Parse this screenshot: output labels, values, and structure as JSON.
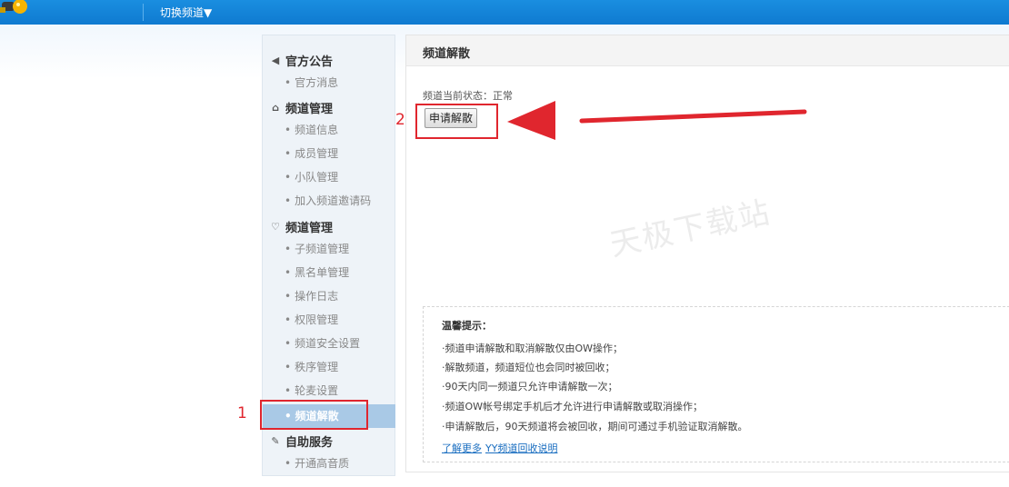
{
  "topbar": {
    "switch_label": "切换频道▼"
  },
  "sidebar": {
    "groups": [
      {
        "label": "官方公告",
        "icon": "speaker-icon"
      },
      {
        "label": "频道管理",
        "icon": "home-icon"
      },
      {
        "label": "频道管理",
        "icon": "shield-icon"
      },
      {
        "label": "自助服务",
        "icon": "wrench-icon"
      }
    ],
    "items": [
      {
        "label": "官方消息"
      },
      {
        "label": "频道信息"
      },
      {
        "label": "成员管理"
      },
      {
        "label": "小队管理"
      },
      {
        "label": "加入频道邀请码"
      },
      {
        "label": "子频道管理"
      },
      {
        "label": "黑名单管理"
      },
      {
        "label": "操作日志"
      },
      {
        "label": "权限管理"
      },
      {
        "label": "频道安全设置"
      },
      {
        "label": "秩序管理"
      },
      {
        "label": "轮麦设置"
      },
      {
        "label": "频道解散",
        "active": true
      },
      {
        "label": "开通高音质"
      }
    ],
    "bullet": "•"
  },
  "main": {
    "title": "频道解散",
    "status_label": "频道当前状态：",
    "status_value": "正常",
    "dissolve_button": "申请解散",
    "watermark": "天极下载站"
  },
  "tips": {
    "title": "温馨提示：",
    "lines": [
      "·频道申请解散和取消解散仅由OW操作；",
      "·解散频道，频道短位也会同时被回收；",
      "·90天内同一频道只允许申请解散一次；",
      "·频道OW帐号绑定手机后才允许进行申请解散或取消操作；",
      "·申请解散后，90天频道将会被回收，期间可通过手机验证取消解散。"
    ],
    "link_more": "了解更多",
    "link_recycle": "YY频道回收说明"
  },
  "annotations": {
    "label_1": "1",
    "label_2": "2",
    "color": "#e0262e"
  }
}
